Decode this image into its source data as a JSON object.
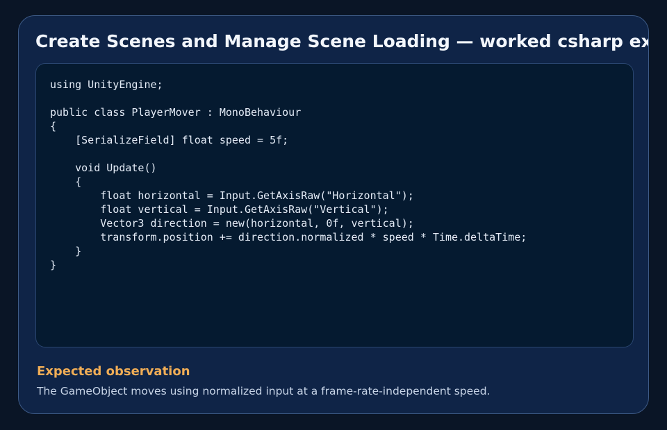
{
  "card": {
    "title": "Create Scenes and Manage Scene Loading — worked csharp example"
  },
  "code": {
    "language": "csharp",
    "lines": [
      "using UnityEngine;",
      "",
      "public class PlayerMover : MonoBehaviour",
      "{",
      "    [SerializeField] float speed = 5f;",
      "",
      "    void Update()",
      "    {",
      "        float horizontal = Input.GetAxisRaw(\"Horizontal\");",
      "        float vertical = Input.GetAxisRaw(\"Vertical\");",
      "        Vector3 direction = new(horizontal, 0f, vertical);",
      "        transform.position += direction.normalized * speed * Time.deltaTime;",
      "    }",
      "}"
    ]
  },
  "observation": {
    "heading": "Expected observation",
    "text": "The GameObject moves using normalized input at a frame-rate-independent speed."
  },
  "colors": {
    "background": "#0a1526",
    "card": "#0f2447",
    "code_panel": "#051a30",
    "accent_heading": "#f0ad56",
    "title_text": "#f2f6fc"
  }
}
